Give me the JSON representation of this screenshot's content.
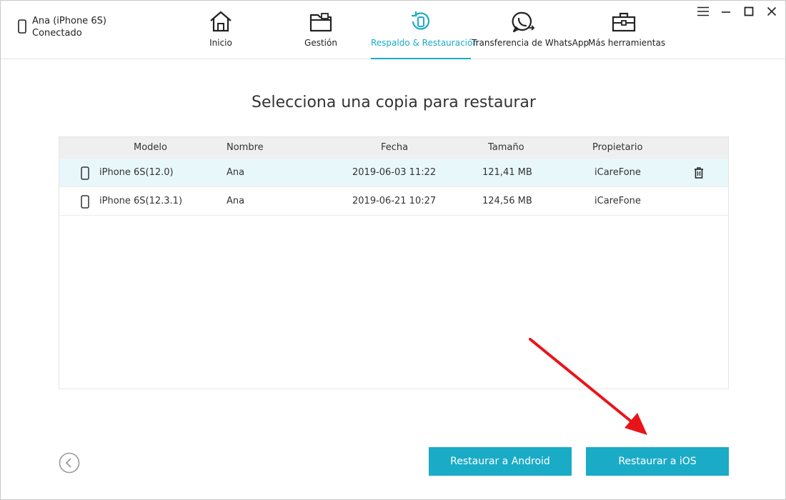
{
  "device": {
    "name": "Ana (iPhone 6S)",
    "status": "Conectado"
  },
  "nav": [
    {
      "label": "Inicio",
      "icon": "home-icon"
    },
    {
      "label": "Gestión",
      "icon": "folder-icon"
    },
    {
      "label": "Respaldo & Restauración",
      "icon": "backup-restore-icon",
      "active": true
    },
    {
      "label": "Transferencia de WhatsApp",
      "icon": "whatsapp-icon"
    },
    {
      "label": "Más herramientas",
      "icon": "toolbox-icon"
    }
  ],
  "title": "Selecciona una copia para restaurar",
  "table": {
    "headers": [
      "Modelo",
      "Nombre",
      "Fecha",
      "Tamaño",
      "Propietario"
    ],
    "rows": [
      {
        "model": "iPhone 6S(12.0)",
        "name": "Ana",
        "date": "2019-06-03 11:22",
        "size": "121,41 MB",
        "owner": "iCareFone",
        "selected": true
      },
      {
        "model": "iPhone 6S(12.3.1)",
        "name": "Ana",
        "date": "2019-06-21 10:27",
        "size": "124,56 MB",
        "owner": "iCareFone",
        "selected": false
      }
    ]
  },
  "buttons": {
    "restore_android": "Restaurar a Android",
    "restore_ios": "Restaurar a iOS"
  },
  "colors": {
    "accent": "#1aabc7",
    "selected_row": "#e8f7f9",
    "arrow": "#e8141a"
  }
}
